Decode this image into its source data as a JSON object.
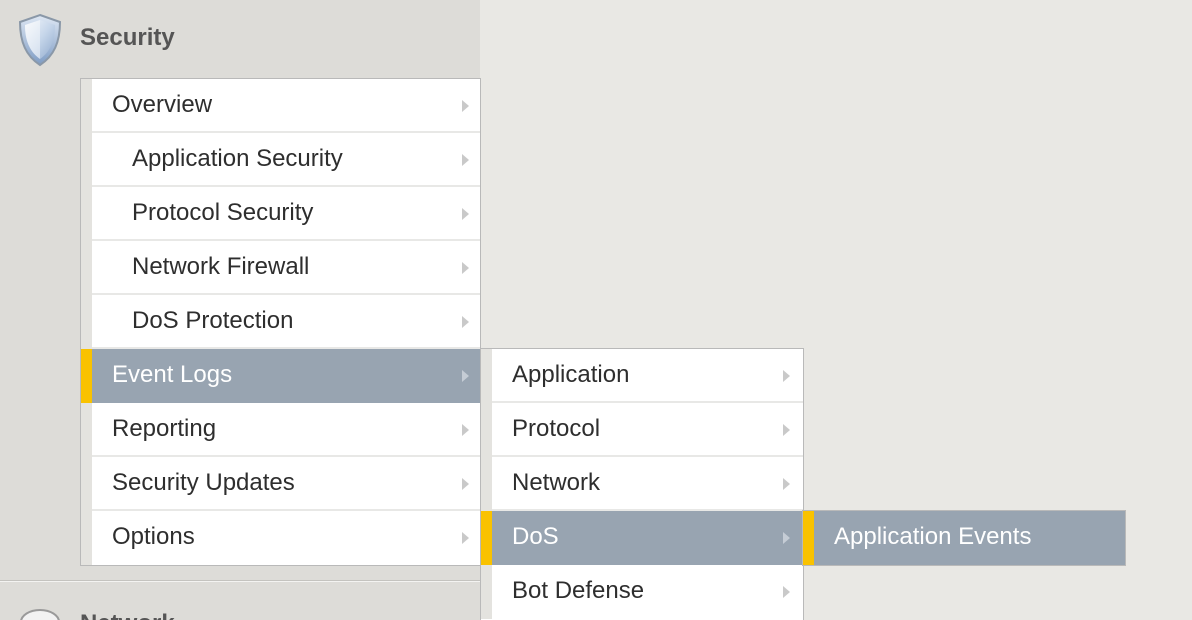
{
  "security": {
    "title": "Security",
    "icon": "shield-icon"
  },
  "next_section": {
    "title": "Network",
    "icon": "network-icon"
  },
  "colors": {
    "selected_bg": "#98a4b1",
    "accent": "#f9c200",
    "menu_bg": "#ffffff",
    "sidebar_bg": "#dddcd8",
    "page_bg": "#e9e8e4"
  },
  "menu_level1": [
    {
      "label": "Overview",
      "indent": 1,
      "selected": false,
      "has_submenu": true
    },
    {
      "label": "Application Security",
      "indent": 2,
      "selected": false,
      "has_submenu": true
    },
    {
      "label": "Protocol Security",
      "indent": 2,
      "selected": false,
      "has_submenu": true
    },
    {
      "label": "Network Firewall",
      "indent": 2,
      "selected": false,
      "has_submenu": true
    },
    {
      "label": "DoS Protection",
      "indent": 2,
      "selected": false,
      "has_submenu": true
    },
    {
      "label": "Event Logs",
      "indent": 1,
      "selected": true,
      "has_submenu": true
    },
    {
      "label": "Reporting",
      "indent": 1,
      "selected": false,
      "has_submenu": true
    },
    {
      "label": "Security Updates",
      "indent": 1,
      "selected": false,
      "has_submenu": true
    },
    {
      "label": "Options",
      "indent": 1,
      "selected": false,
      "has_submenu": true
    }
  ],
  "menu_level2": [
    {
      "label": "Application",
      "selected": false,
      "has_submenu": true
    },
    {
      "label": "Protocol",
      "selected": false,
      "has_submenu": true
    },
    {
      "label": "Network",
      "selected": false,
      "has_submenu": true
    },
    {
      "label": "DoS",
      "selected": true,
      "has_submenu": true
    },
    {
      "label": "Bot Defense",
      "selected": false,
      "has_submenu": true
    }
  ],
  "menu_level3": [
    {
      "label": "Application Events",
      "selected": true,
      "has_submenu": false
    }
  ]
}
